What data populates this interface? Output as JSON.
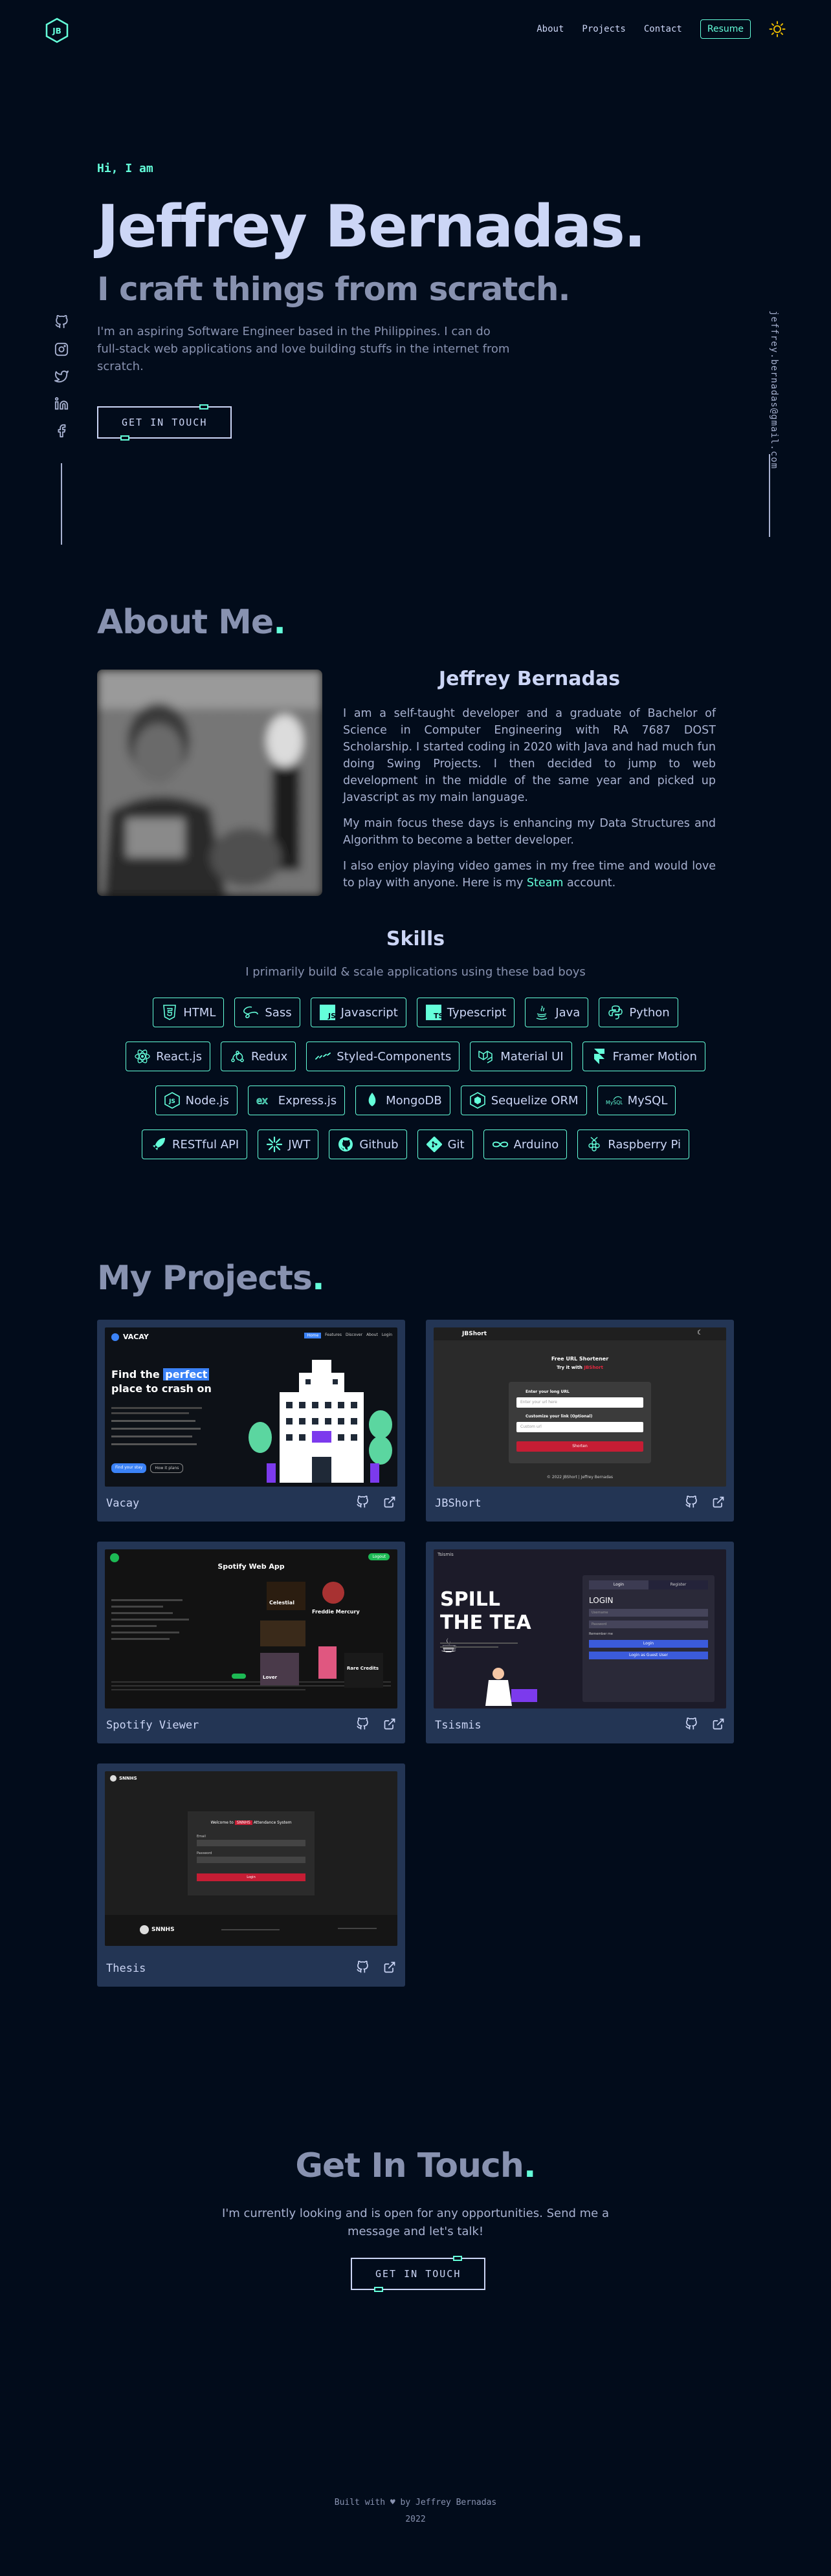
{
  "nav": {
    "logo": "JB",
    "links": [
      "About",
      "Projects",
      "Contact"
    ],
    "resume_label": "Resume"
  },
  "hero": {
    "greeting": "Hi, I am",
    "name": "Jeffrey Bernadas.",
    "tagline": "I craft things from scratch.",
    "intro": "I'm an aspiring Software Engineer based in the Philippines. I can do full-stack web applications and love building stuffs in the internet from scratch.",
    "cta": "GET IN TOUCH"
  },
  "sidebar": {
    "email": "jeffrey.bernadas@gmail.com",
    "social_icons": [
      "github-icon",
      "instagram-icon",
      "twitter-icon",
      "linkedin-icon",
      "facebook-icon"
    ]
  },
  "about": {
    "title": "About Me",
    "title_dot": ".",
    "name": "Jeffrey Bernadas",
    "p1": "I am a self-taught developer and a graduate of Bachelor of Science in Computer Engineering with RA 7687 DOST Scholarship. I started coding in 2020 with Java and had much fun doing Swing Projects. I then decided to jump to web development in the middle of the same year and picked up Javascript as my main language.",
    "p2": "My main focus these days is enhancing my Data Structures and Algorithm to become a better developer.",
    "p3_before": "I also enjoy playing video games in my free time and would love to play with anyone. Here is my ",
    "p3_link": "Steam",
    "p3_after": " account."
  },
  "skills": {
    "title": "Skills",
    "subtitle": "I primarily build & scale applications using these bad boys",
    "rows": [
      [
        "HTML",
        "Sass",
        "Javascript",
        "Typescript",
        "Java",
        "Python"
      ],
      [
        "React.js",
        "Redux",
        "Styled-Components",
        "Material UI",
        "Framer Motion"
      ],
      [
        "Node.js",
        "Express.js",
        "MongoDB",
        "Sequelize ORM",
        "MySQL"
      ],
      [
        "RESTful API",
        "JWT",
        "Github",
        "Git",
        "Arduino",
        "Raspberry Pi"
      ]
    ]
  },
  "projects": {
    "title": "My Projects",
    "title_dot": ".",
    "items": [
      {
        "name": "Vacay",
        "shot": {
          "brand": "VACAY",
          "nav": [
            "Home",
            "Features",
            "Discover",
            "About",
            "Login"
          ],
          "headline_1": "Find the",
          "headline_highlight": "perfect",
          "headline_2": "place to crash on",
          "btn1": "Find your stay",
          "btn2": "How it plans"
        }
      },
      {
        "name": "JBShort",
        "shot": {
          "brand": "JBShort",
          "title": "Free URL Shortener",
          "subtitle_prefix": "Try it with",
          "subtitle_highlight": "JBShort",
          "label1": "Enter your long URL",
          "placeholder1": "Enter your url here",
          "label2": "Customize your link (Optional)",
          "placeholder2": "Custom url",
          "button": "Shorten",
          "footer": "© 2022 JBShort | Jeffrey Bernadas"
        }
      },
      {
        "name": "Spotify Viewer",
        "shot": {
          "title": "Spotify Web App",
          "tag": "Logout",
          "cards": [
            "Celestial",
            "Freddie Mercury",
            "Lover",
            "Rare Credits"
          ]
        }
      },
      {
        "name": "Tsismis",
        "shot": {
          "brand": "Tsismis",
          "headline": "SPILL THE TEA",
          "tea_icon": "☕",
          "tab1": "Login",
          "tab2": "Register",
          "form_title": "LOGIN",
          "field1": "Username",
          "field2": "Password",
          "remember": "Remember me",
          "btn1": "Login",
          "btn2": "Login as Guest User"
        }
      },
      {
        "name": "Thesis",
        "shot": {
          "brand": "SNNHS",
          "welcome_prefix": "Welcome to",
          "welcome_highlight": "SNNHS",
          "welcome_suffix": "Attendance System",
          "label1": "Email",
          "label2": "Password",
          "button": "Login",
          "footer_brand": "SNNHS"
        }
      }
    ]
  },
  "contact": {
    "title": "Get In Touch",
    "title_dot": ".",
    "text": "I'm currently looking and is open for any opportunities. Send me a message and let's talk!",
    "cta": "GET IN TOUCH"
  },
  "footer": {
    "line1_prefix": "Built with",
    "heart": "♥",
    "line1_suffix": "by Jeffrey Bernadas",
    "year": "2022"
  },
  "colors": {
    "background": "#020c1b",
    "accent": "#64ffda",
    "card": "#233554",
    "text": "#ccd6f6",
    "muted": "#8892b0"
  }
}
